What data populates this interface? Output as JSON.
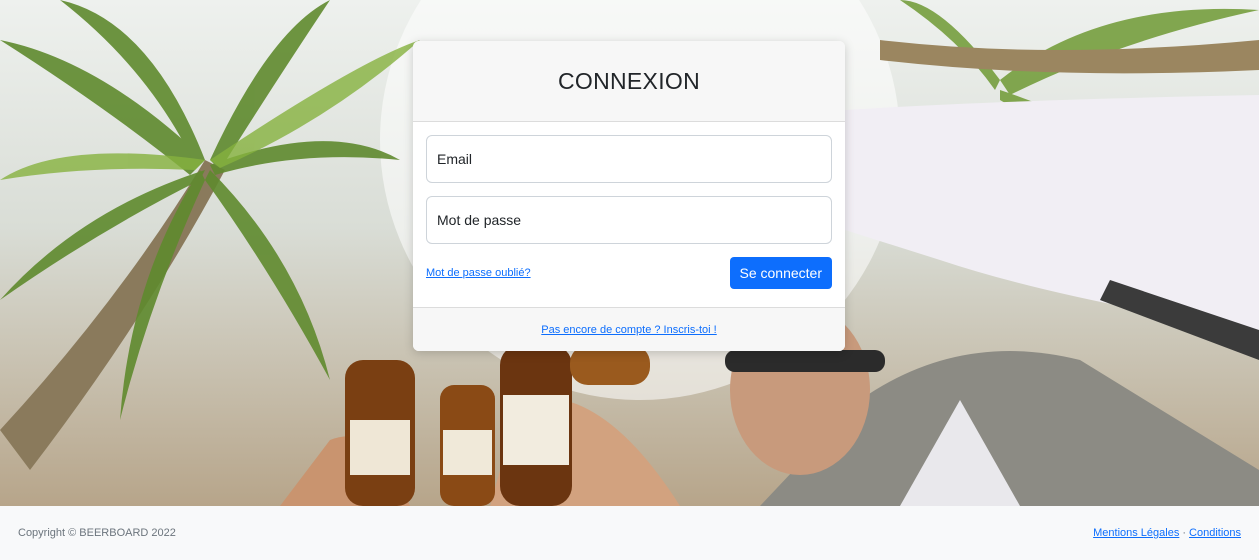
{
  "login": {
    "title": "CONNEXION",
    "email_placeholder": "Email",
    "password_placeholder": "Mot de passe",
    "forgot_password": "Mot de passe oublié?",
    "submit": "Se connecter",
    "signup": "Pas encore de compte ? Inscris-toi !"
  },
  "footer": {
    "copyright": "Copyright © BEERBOARD 2022",
    "legal": "Mentions Légales",
    "separator": "·",
    "terms": "Conditions"
  },
  "colors": {
    "primary": "#0d6efd",
    "card_header": "#f7f7f7",
    "footer_bg": "#f8f9fa"
  }
}
